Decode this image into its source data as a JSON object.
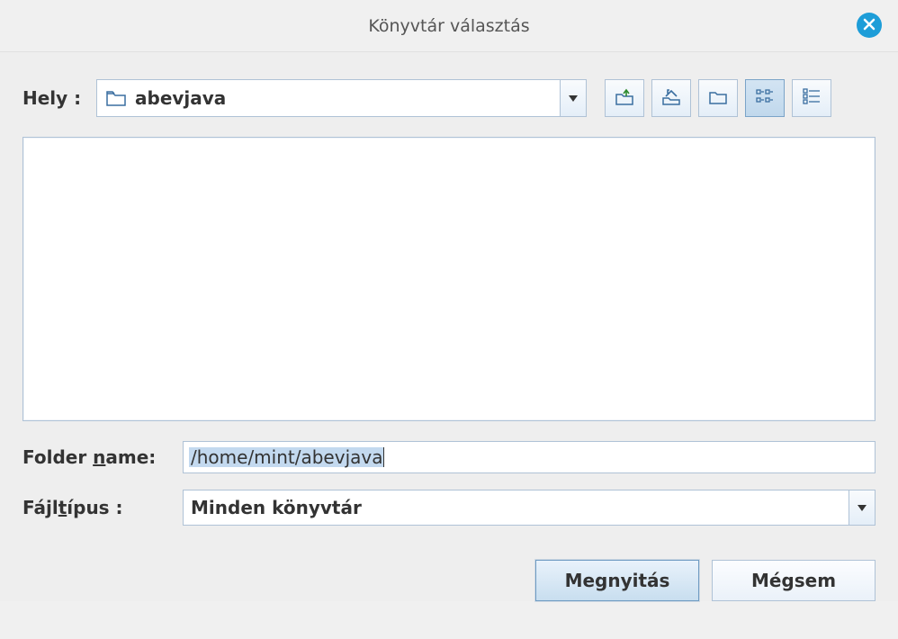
{
  "title": "Könyvtár választás",
  "location": {
    "label": "Hely :",
    "selected": "abevjava"
  },
  "folder_name": {
    "label_pre": "Folder ",
    "label_under": "n",
    "label_post": "ame:",
    "value": "/home/mint/abevjava"
  },
  "file_type": {
    "label_pre": "Fájl",
    "label_under": "t",
    "label_post": "ípus :",
    "selected": "Minden könyvtár"
  },
  "buttons": {
    "open": "Megnyitás",
    "cancel": "Mégsem"
  },
  "icons": {
    "close": "close-icon",
    "folder": "folder-icon",
    "folder_up": "folder-up-icon",
    "home": "home-icon",
    "new_folder": "new-folder-icon",
    "view_icons": "view-icons-icon",
    "view_list": "view-list-icon",
    "chevron_down": "chevron-down-icon"
  }
}
